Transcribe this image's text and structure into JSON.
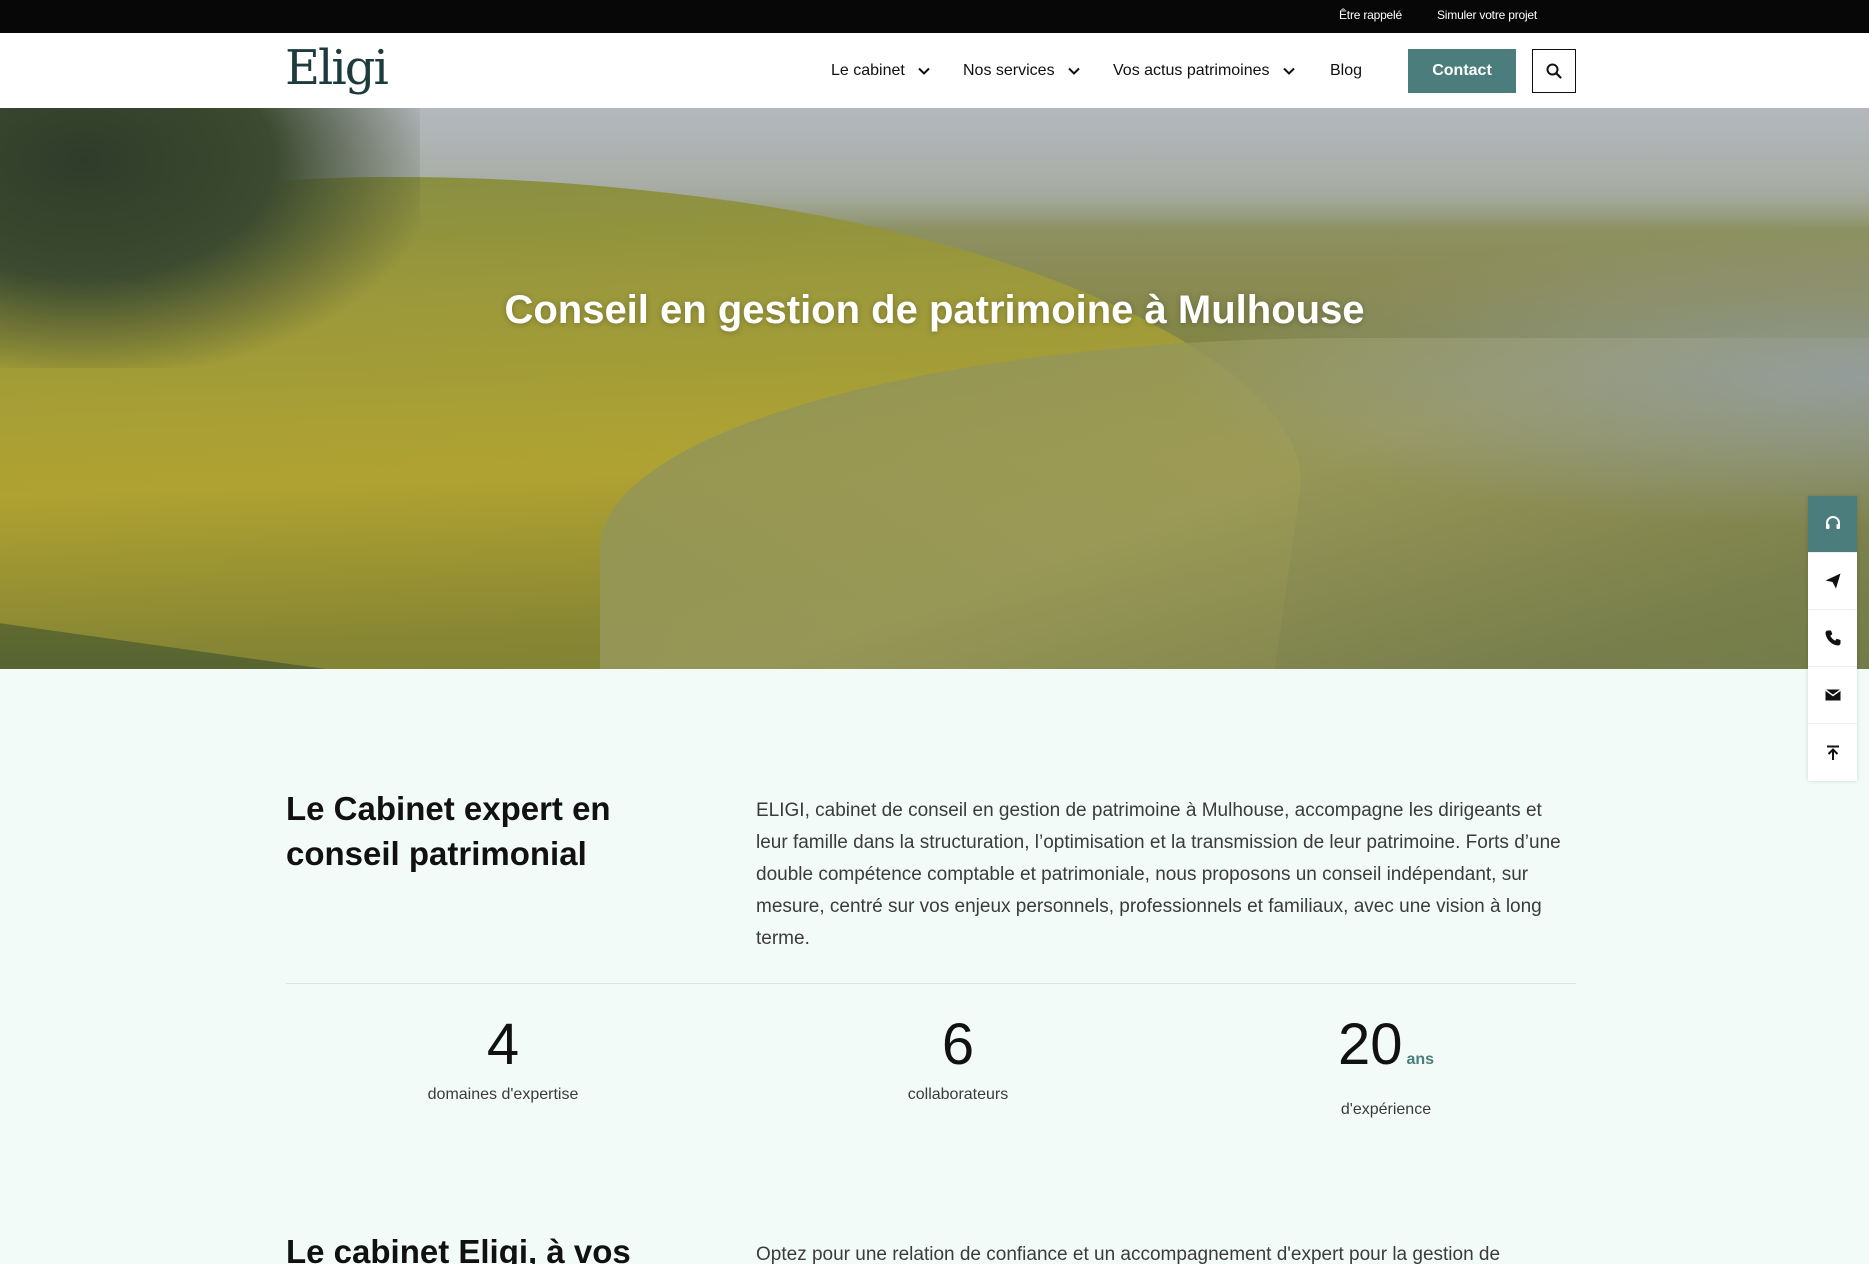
{
  "topbar": {
    "callback": "Être rappelé",
    "simulate": "Simuler votre projet"
  },
  "header": {
    "logo": "Eligi",
    "nav": [
      {
        "label": "Le cabinet",
        "dropdown": true
      },
      {
        "label": "Nos services",
        "dropdown": true
      },
      {
        "label": "Vos actus patrimoines",
        "dropdown": true
      },
      {
        "label": "Blog",
        "dropdown": false
      }
    ],
    "contact_label": "Contact",
    "search_icon": "search-icon"
  },
  "hero": {
    "title": "Conseil en gestion de patrimoine à Mulhouse"
  },
  "sidebar": {
    "icons": [
      "headset-icon",
      "paper-plane-icon",
      "phone-icon",
      "envelope-icon",
      "arrow-up-to-top-icon"
    ]
  },
  "about": {
    "title": "Le Cabinet expert en conseil patrimonial",
    "text": "ELIGI, cabinet de conseil en gestion de patrimoine à Mulhouse, accompagne les dirigeants et leur famille dans la structuration, l’optimisation et la transmission de leur patrimoine. Forts d’une double compétence comptable et patrimoniale, nous proposons un conseil indépendant, sur mesure, centré sur vos enjeux personnels, professionnels et familiaux, avec une vision à long terme."
  },
  "stats": [
    {
      "value": "4",
      "unit": "",
      "label": "domaines d'expertise"
    },
    {
      "value": "6",
      "unit": "",
      "label": "collaborateurs"
    },
    {
      "value": "20",
      "unit": "ans",
      "label": "d'expérience"
    }
  ],
  "section2": {
    "title": "Le cabinet Eligi, à vos",
    "text": "Optez pour une relation de confiance et un accompagnement d'expert pour la gestion de"
  },
  "colors": {
    "accent": "#4a7d7b",
    "topbar": "#070707",
    "page_bg": "#f3fbf9"
  }
}
